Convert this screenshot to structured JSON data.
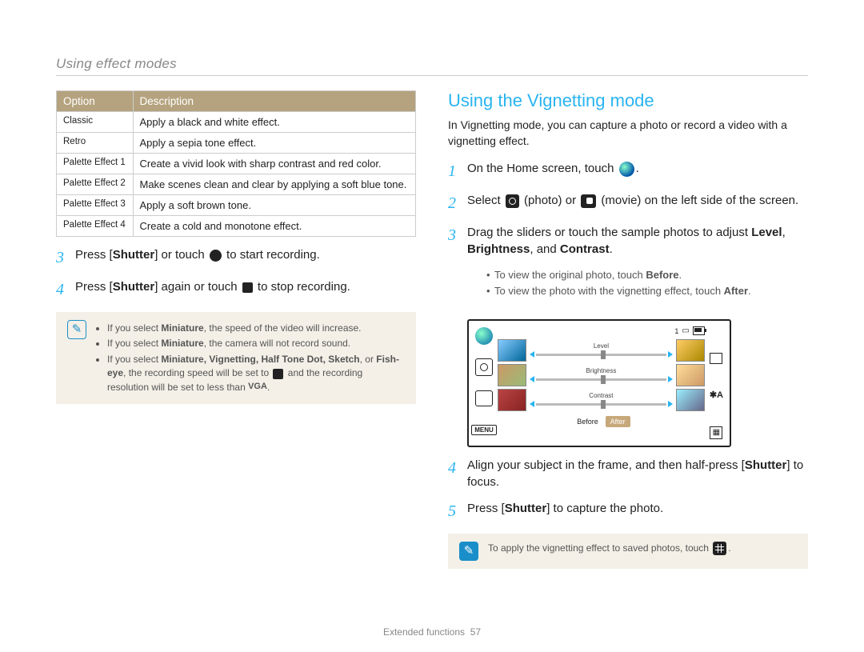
{
  "header": {
    "section_title": "Using effect modes"
  },
  "table": {
    "col_option": "Option",
    "col_desc": "Description",
    "rows": [
      {
        "name": "Classic",
        "desc": "Apply a black and white effect."
      },
      {
        "name": "Retro",
        "desc": "Apply a sepia tone effect."
      },
      {
        "name": "Palette Effect 1",
        "desc": "Create a vivid look with sharp contrast and red color."
      },
      {
        "name": "Palette Effect 2",
        "desc": "Make scenes clean and clear by applying a soft blue tone."
      },
      {
        "name": "Palette Effect 3",
        "desc": "Apply a soft brown tone."
      },
      {
        "name": "Palette Effect 4",
        "desc": "Create a cold and monotone effect."
      }
    ]
  },
  "left_steps": {
    "s3": {
      "num": "3",
      "pre": "Press [",
      "shutter": "Shutter",
      "mid": "] or touch ",
      "post": " to start recording."
    },
    "s4": {
      "num": "4",
      "pre": "Press [",
      "shutter": "Shutter",
      "mid": "] again or touch ",
      "post": " to stop recording."
    }
  },
  "left_note": {
    "b1": "If you select ",
    "min": "Miniature",
    "b1b": ", the speed of the video will increase.",
    "b2": "If you select ",
    "b2b": ", the camera will not record sound.",
    "b3a": "If you select ",
    "list": "Miniature, Vignetting, Half Tone Dot, Sketch",
    "b3b": ", or ",
    "fisheye": "Fish-eye",
    "b3c": ", the recording speed will be set to ",
    "b3d": " and the recording resolution will be set to less than ",
    "vga": "VGA",
    "b3e": "."
  },
  "right": {
    "heading": "Using the Vignetting mode",
    "intro": "In Vignetting mode, you can capture a photo or record a video with a vignetting effect.",
    "s1": {
      "num": "1",
      "a": "On the Home screen, touch ",
      "b": "."
    },
    "s2": {
      "num": "2",
      "a": "Select ",
      "b": " (photo) or ",
      "c": " (movie) on the left side of the screen."
    },
    "s3": {
      "num": "3",
      "a": "Drag the sliders or touch the sample photos to adjust ",
      "lv": "Level",
      "sep1": ", ",
      "br": "Brightness",
      "sep2": ", and ",
      "ct": "Contrast",
      "b": "."
    },
    "s3_sub": {
      "a1": "To view the original photo, touch ",
      "before": "Before",
      "a2": ".",
      "b1": "To view the photo with the vignetting effect, touch ",
      "after": "After",
      "b2": "."
    },
    "s4": {
      "num": "4",
      "a": "Align your subject in the frame, and then half-press [",
      "shutter": "Shutter",
      "b": "] to focus."
    },
    "s5": {
      "num": "5",
      "a": "Press [",
      "shutter": "Shutter",
      "b": "] to capture the photo."
    }
  },
  "right_note": {
    "a": "To apply the vignetting effect to saved photos, touch ",
    "b": "."
  },
  "lcd": {
    "count": "1",
    "menu": "MENU",
    "sliders": [
      "Level",
      "Brightness",
      "Contrast"
    ],
    "before": "Before",
    "after": "After",
    "flash": "✱A"
  },
  "footer": {
    "label": "Extended functions",
    "page": "57"
  }
}
